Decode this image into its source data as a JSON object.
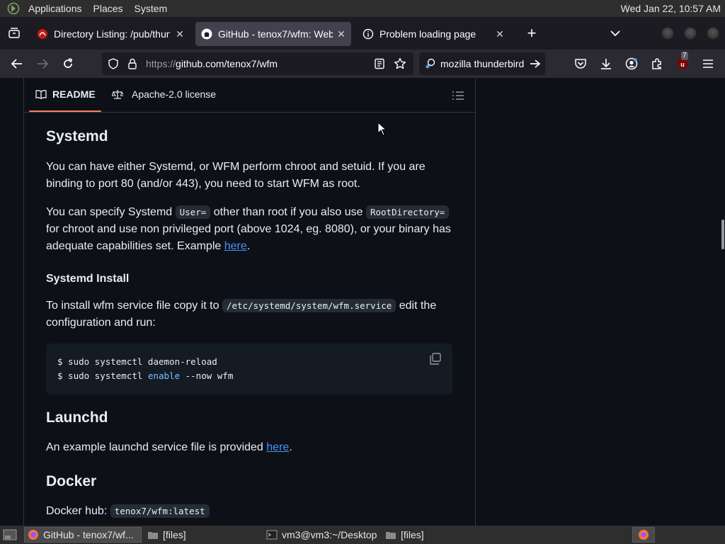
{
  "top_panel": {
    "menus": [
      "Applications",
      "Places",
      "System"
    ],
    "clock": "Wed Jan 22, 10:57 AM"
  },
  "tabs": [
    {
      "title": "Directory Listing: /pub/thun",
      "active": false
    },
    {
      "title": "GitHub - tenox7/wfm: Web",
      "active": true
    },
    {
      "title": "Problem loading page",
      "active": false
    }
  ],
  "navbar": {
    "url_prefix": "https://",
    "url_main": "github.com/tenox7/wfm",
    "search_text": "mozilla thunderbird",
    "extension_badge": "7"
  },
  "readme": {
    "tabs": [
      "README",
      "Apache-2.0 license"
    ],
    "h_systemd": "Systemd",
    "p1": "You can have either Systemd, or WFM perform chroot and setuid. If you are binding to port 80 (and/or 443), you need to start WFM as root.",
    "p2_a": "You can specify Systemd",
    "p2_code1": "User=",
    "p2_b": "other than root if you also use",
    "p2_code2": "RootDirectory=",
    "p2_c": "for chroot and use non privileged port (above 1024, eg. 8080), or your binary has adequate capabilities set. Example",
    "p2_link": "here",
    "p2_end": ".",
    "h_install": "Systemd Install",
    "p3_a": "To install wfm service file copy it to",
    "p3_code": "/etc/systemd/system/wfm.service",
    "p3_b": "edit the configuration and run:",
    "code_line1": "$ sudo systemctl daemon-reload",
    "code_line2_a": "$ sudo systemctl ",
    "code_line2_kw": "enable",
    "code_line2_b": " --now wfm",
    "h_launchd": "Launchd",
    "p4_a": "An example launchd service file is provided",
    "p4_link": "here",
    "p4_end": ".",
    "h_docker": "Docker",
    "p5_a": "Docker hub:",
    "p5_code": "tenox7/wfm:latest"
  },
  "taskbar": [
    {
      "label": "GitHub - tenox7/wf...",
      "active": true
    },
    {
      "label": "[files]",
      "active": false
    },
    {
      "label": "vm3@vm3:~/Desktop",
      "active": false
    },
    {
      "label": "[files]",
      "active": false
    }
  ],
  "colors": {
    "page_bg": "#0d1117",
    "link": "#4493f8",
    "tab_underline": "#f78166",
    "ublock_red": "#c0392b"
  }
}
